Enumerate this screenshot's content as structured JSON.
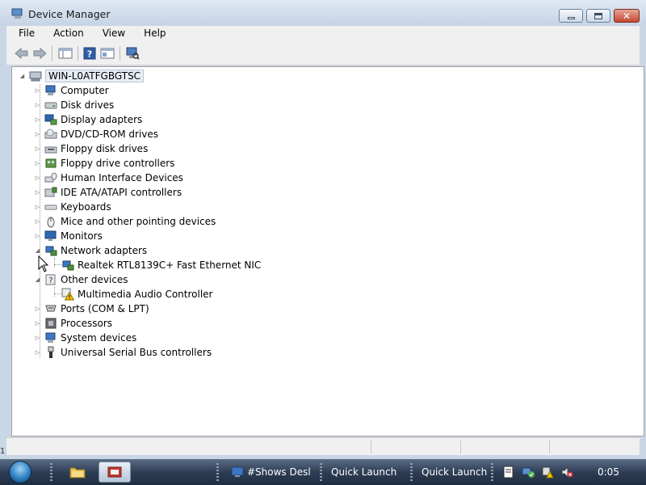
{
  "window": {
    "title": "Device Manager",
    "app_icon": "device-manager-icon"
  },
  "menu": {
    "items": [
      "File",
      "Action",
      "View",
      "Help"
    ]
  },
  "toolbar": {
    "buttons": [
      "back-arrow-icon",
      "forward-arrow-icon",
      "properties-view-icon",
      "help-icon",
      "show-hide-console-tree-icon",
      "scan-hardware-icon"
    ]
  },
  "tree": {
    "root": "WIN-L0ATFGBGTSC",
    "categories": [
      {
        "label": "Computer",
        "icon": "computer-icon",
        "expanded": false
      },
      {
        "label": "Disk drives",
        "icon": "disk-drive-icon",
        "expanded": false
      },
      {
        "label": "Display adapters",
        "icon": "display-adapter-icon",
        "expanded": false
      },
      {
        "label": "DVD/CD-ROM drives",
        "icon": "dvd-drive-icon",
        "expanded": false
      },
      {
        "label": "Floppy disk drives",
        "icon": "floppy-drive-icon",
        "expanded": false
      },
      {
        "label": "Floppy drive controllers",
        "icon": "floppy-controller-icon",
        "expanded": false
      },
      {
        "label": "Human Interface Devices",
        "icon": "hid-icon",
        "expanded": false
      },
      {
        "label": "IDE ATA/ATAPI controllers",
        "icon": "ide-controller-icon",
        "expanded": false
      },
      {
        "label": "Keyboards",
        "icon": "keyboard-icon",
        "expanded": false
      },
      {
        "label": "Mice and other pointing devices",
        "icon": "mouse-icon",
        "expanded": false
      },
      {
        "label": "Monitors",
        "icon": "monitor-icon",
        "expanded": false
      },
      {
        "label": "Network adapters",
        "icon": "network-adapter-icon",
        "expanded": true,
        "children": [
          {
            "label": "Realtek RTL8139C+ Fast Ethernet NIC",
            "icon": "network-card-icon"
          }
        ]
      },
      {
        "label": "Other devices",
        "icon": "unknown-device-icon",
        "expanded": true,
        "children": [
          {
            "label": "Multimedia Audio Controller",
            "icon": "warning-device-icon"
          }
        ]
      },
      {
        "label": "Ports (COM & LPT)",
        "icon": "port-icon",
        "expanded": false
      },
      {
        "label": "Processors",
        "icon": "processor-icon",
        "expanded": false
      },
      {
        "label": "System devices",
        "icon": "system-device-icon",
        "expanded": false
      },
      {
        "label": "Universal Serial Bus controllers",
        "icon": "usb-icon",
        "expanded": false
      }
    ]
  },
  "taskbar": {
    "tasks": [
      "#Shows Desl",
      "Quick Launch",
      "Quick Launch"
    ],
    "clock": "0:05",
    "tray_icons": [
      "action-center-icon",
      "network-icon",
      "volume-muted-icon"
    ]
  },
  "left_edge_text": "1",
  "colors": {
    "titlebar": "#c5d4e6",
    "close_button": "#c4482f",
    "taskbar": "#2e3e55",
    "warning": "#f2c200"
  }
}
